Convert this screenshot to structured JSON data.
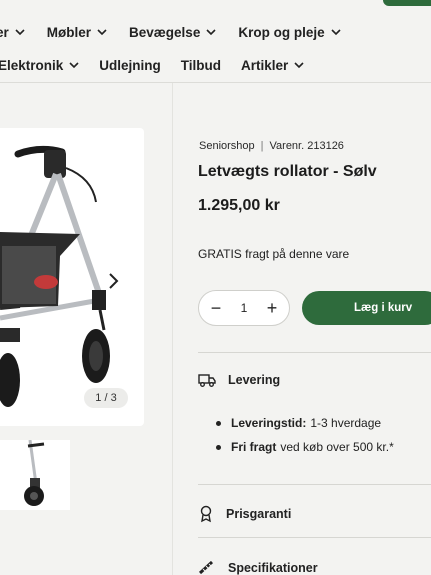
{
  "nav": {
    "row1": [
      {
        "label": "er",
        "has_chevron": true
      },
      {
        "label": "Møbler",
        "has_chevron": true
      },
      {
        "label": "Bevægelse",
        "has_chevron": true
      },
      {
        "label": "Krop og pleje",
        "has_chevron": true
      }
    ],
    "row2": [
      {
        "label": "Elektronik",
        "has_chevron": true
      },
      {
        "label": "Udlejning",
        "has_chevron": false
      },
      {
        "label": "Tilbud",
        "has_chevron": false
      },
      {
        "label": "Artikler",
        "has_chevron": true
      }
    ]
  },
  "gallery": {
    "counter": "1 / 3",
    "next_icon": "chevron-right-icon"
  },
  "product": {
    "brand": "Seniorshop",
    "sku": "Varenr. 213126",
    "title": "Letvægts rollator - Sølv",
    "price": "1.295,00 kr",
    "shipping_note": "GRATIS fragt på denne vare"
  },
  "cart": {
    "qty_minus": "−",
    "qty_value": "1",
    "qty_plus": "+",
    "add_label": "Læg i kurv"
  },
  "sections": {
    "delivery": {
      "title": "Levering",
      "icon": "truck-icon",
      "items": [
        {
          "label": "Leveringstid:",
          "value": "1-3 hverdage"
        },
        {
          "label": "Fri fragt",
          "value": "ved køb over 500 kr.*"
        }
      ]
    },
    "guarantee": {
      "title": "Prisgaranti",
      "icon": "award-icon"
    },
    "specs": {
      "title": "Specifikationer",
      "icon": "ruler-icon"
    }
  },
  "colors": {
    "accent": "#2e6b3c",
    "background": "#f3f3f1"
  }
}
